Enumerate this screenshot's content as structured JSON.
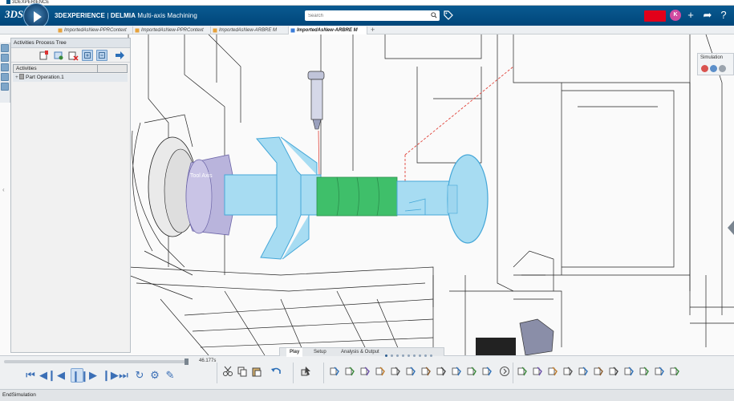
{
  "os_window": {
    "title": "3DEXPERIENCE"
  },
  "header": {
    "brand": "3DEXPERIENCE",
    "separator": " | ",
    "product": "DELMIA",
    "app": " Multi-axis Machining",
    "search_placeholder": "Search",
    "user_initial": "K"
  },
  "tabs": [
    {
      "label": "ImportedAsNew-PPRContext",
      "active": false
    },
    {
      "label": "ImportedAsNew-PPRContext",
      "active": false
    },
    {
      "label": "ImportedAsNew-ARBRE M",
      "active": false
    },
    {
      "label": "ImportedAsNew-ARBRE M",
      "active": true
    }
  ],
  "activities_panel": {
    "title": "Activities Process Tree",
    "column_header": "Activities",
    "rows": [
      {
        "label": "Part Operation.1"
      }
    ]
  },
  "viewport": {
    "annotation": "Tool Axis"
  },
  "simulation_panel": {
    "title": "Simulation"
  },
  "playback": {
    "time": "46.177s"
  },
  "ribbon": {
    "tabs": [
      {
        "label": "Play",
        "active": true
      },
      {
        "label": "Setup",
        "active": false
      },
      {
        "label": "Analysis & Output",
        "active": false
      }
    ]
  },
  "status": {
    "text": "EndSimulation"
  },
  "colors": {
    "header_blue": "#00467a",
    "part_blue": "#9fd9f2",
    "groove_green": "#3fbf6a",
    "chuck_purple": "#b9b4dc"
  }
}
